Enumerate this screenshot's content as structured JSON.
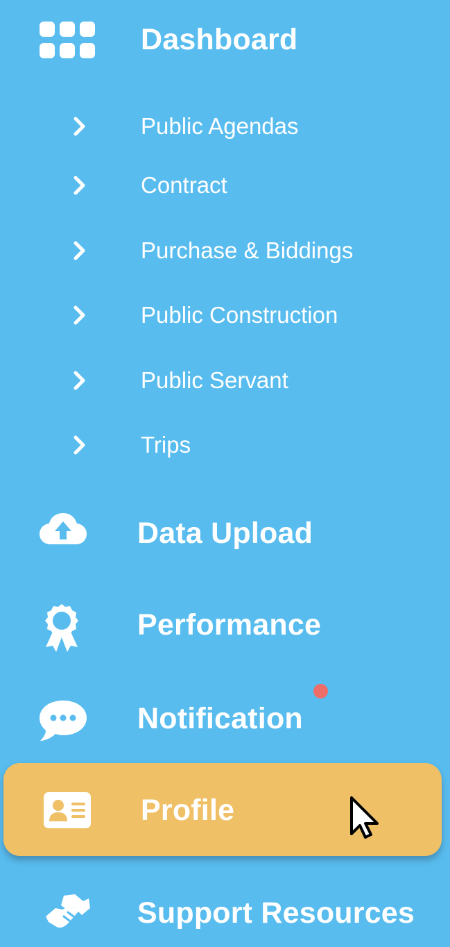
{
  "menu": {
    "dashboard": {
      "label": "Dashboard",
      "icon": "grid-icon"
    },
    "submenu": [
      {
        "label": "Public Agendas",
        "icon": "chevron-right-icon"
      },
      {
        "label": "Contract",
        "icon": "chevron-right-icon"
      },
      {
        "label": "Purchase & Biddings",
        "icon": "chevron-right-icon"
      },
      {
        "label": "Public Construction",
        "icon": "chevron-right-icon"
      },
      {
        "label": "Public Servant",
        "icon": "chevron-right-icon"
      },
      {
        "label": "Trips",
        "icon": "chevron-right-icon"
      }
    ],
    "data_upload": {
      "label": "Data Upload",
      "icon": "cloud-upload-icon"
    },
    "performance": {
      "label": "Performance",
      "icon": "award-ribbon-icon"
    },
    "notification": {
      "label": "Notification",
      "icon": "chat-bubble-icon",
      "has_unread": true
    },
    "profile": {
      "label": "Profile",
      "icon": "id-card-icon",
      "active": true
    },
    "support_resources": {
      "label": "Support Resources",
      "icon": "handshake-icon"
    }
  },
  "colors": {
    "background": "#58bcee",
    "active_item": "#efc066",
    "notification_dot": "#ee6d69",
    "text": "#ffffff"
  }
}
